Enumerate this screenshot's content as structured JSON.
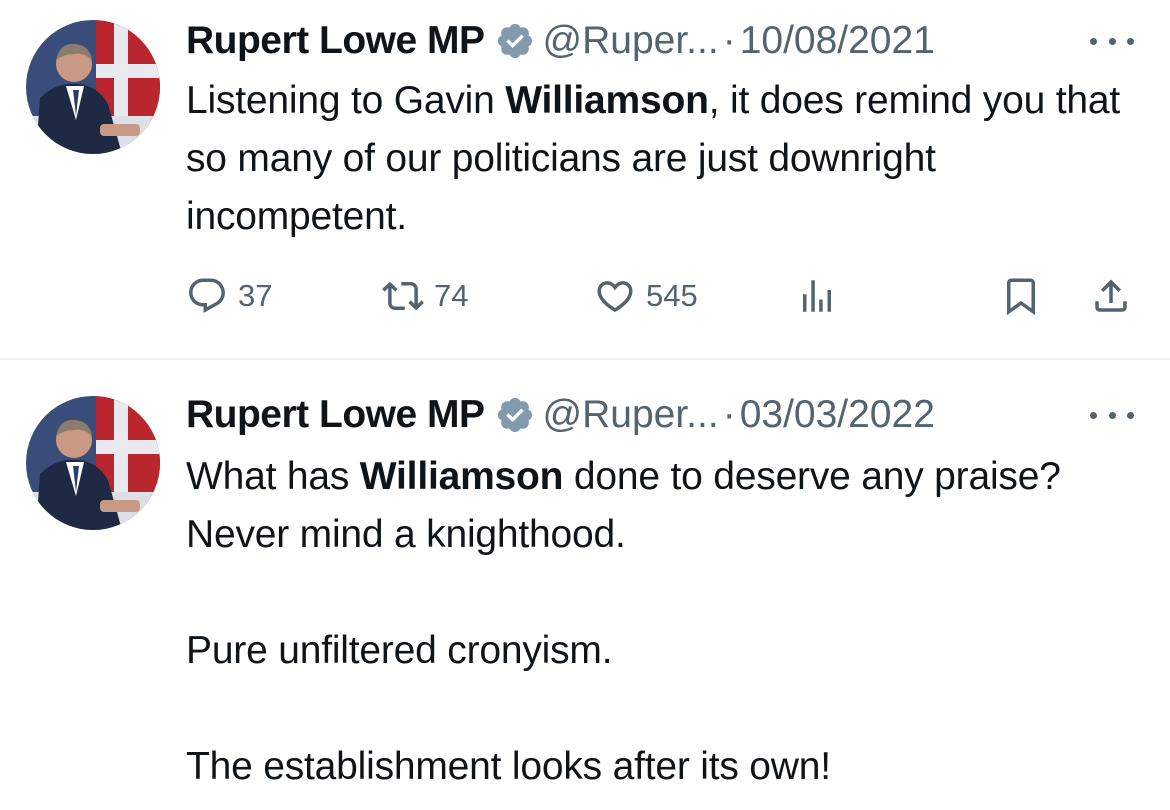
{
  "tweets": [
    {
      "author": {
        "display_name": "Rupert Lowe MP",
        "handle": "@Ruper...",
        "verified_icon": "verified-badge-icon",
        "verified_color": "#829aab"
      },
      "separator": "·",
      "date": "10/08/2021",
      "body": {
        "line1_pre": "Listening to Gavin ",
        "line1_bold": "Williamson",
        "line1_post": ", it does remind you that so many of our politicians are just downright incompetent."
      },
      "actions": {
        "replies": "37",
        "retweets": "74",
        "likes": "545"
      },
      "icons": [
        "reply-icon",
        "retweet-icon",
        "like-icon",
        "views-icon",
        "bookmark-icon",
        "share-icon",
        "more-icon"
      ]
    },
    {
      "author": {
        "display_name": "Rupert Lowe MP",
        "handle": "@Ruper...",
        "verified_icon": "verified-badge-icon",
        "verified_color": "#829aab"
      },
      "separator": "·",
      "date": "03/03/2022",
      "body": {
        "p1_pre": "What has ",
        "p1_bold": "Williamson",
        "p1_post": " done to deserve any praise? Never mind a knighthood.",
        "p2": "Pure unfiltered cronyism.",
        "p3": "The establishment looks after its own!"
      }
    }
  ],
  "colors": {
    "text_primary": "#0f1419",
    "text_secondary": "#536471",
    "divider": "#eff3f4",
    "background": "#ffffff"
  }
}
